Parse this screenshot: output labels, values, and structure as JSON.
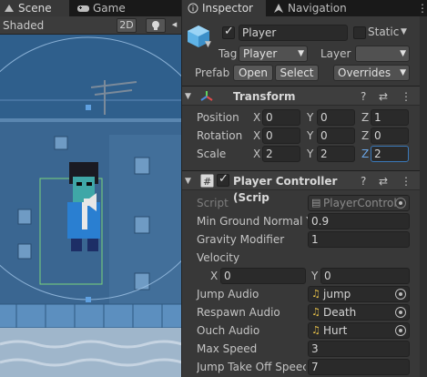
{
  "scene_tabs": {
    "scene": "Scene",
    "game": "Game"
  },
  "scene_toolbar": {
    "shading": "Shaded",
    "mode_2d": "2D"
  },
  "inspector_tabs": {
    "inspector": "Inspector",
    "navigation": "Navigation"
  },
  "object": {
    "name": "Player",
    "static_label": "Static",
    "tag_label": "Tag",
    "tag_value": "Player",
    "layer_label": "Layer",
    "layer_value": "",
    "prefab_label": "Prefab",
    "open_btn": "Open",
    "select_btn": "Select",
    "overrides_btn": "Overrides"
  },
  "transform": {
    "title": "Transform",
    "position_label": "Position",
    "rotation_label": "Rotation",
    "scale_label": "Scale",
    "axes": [
      "X",
      "Y",
      "Z"
    ],
    "position": [
      "0",
      "0",
      "1"
    ],
    "rotation": [
      "0",
      "0",
      "0"
    ],
    "scale": [
      "2",
      "2",
      "2"
    ]
  },
  "player_controller": {
    "title": "Player Controller (Scrip",
    "script_label": "Script",
    "script_value": "PlayerControl",
    "min_ground_normal_y_label": "Min Ground Normal Y",
    "min_ground_normal_y": "0.9",
    "gravity_modifier_label": "Gravity Modifier",
    "gravity_modifier": "1",
    "velocity_label": "Velocity",
    "velocity_x": "0",
    "velocity_y": "0",
    "jump_audio_label": "Jump Audio",
    "jump_audio": "jump",
    "respawn_audio_label": "Respawn Audio",
    "respawn_audio": "Death",
    "ouch_audio_label": "Ouch Audio",
    "ouch_audio": "Hurt",
    "max_speed_label": "Max Speed",
    "max_speed": "3",
    "jump_take_off_label": "Jump Take Off Speec",
    "jump_take_off": "7"
  },
  "colors": {
    "accent_blue": "#3a79bb",
    "scene_sky": "#2d5a86",
    "transform_icon_red": "#e04b4b",
    "prefab_cube": "#5fb3e6"
  },
  "icons": [
    "scene-icon",
    "gamepad-icon",
    "lightbulb-icon",
    "prefab-cube-icon",
    "transform-axis-icon",
    "script-hash-icon",
    "help-icon",
    "preset-icon",
    "kebab-menu-icon",
    "audio-note-icon",
    "object-picker-icon"
  ]
}
